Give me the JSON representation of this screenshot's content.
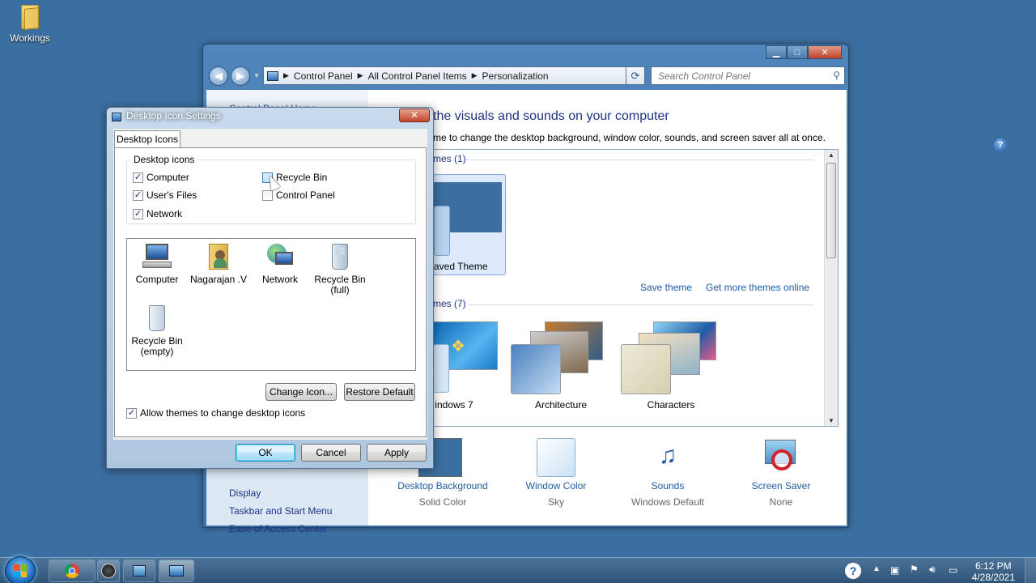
{
  "desktop": {
    "icon_label": "Workings"
  },
  "cp": {
    "address": [
      "Control Panel",
      "All Control Panel Items",
      "Personalization"
    ],
    "search_placeholder": "Search Control Panel",
    "title_partial": "the visuals and sounds on your computer",
    "subtitle_partial": "me to change the desktop background, window color, sounds, and screen saver all at once.",
    "left_top_partial": "Control Panel Home",
    "left_links": [
      "Display",
      "Taskbar and Start Menu",
      "Ease of Access Center"
    ],
    "my_themes_partial": "mes (1)",
    "saved_theme_partial": "aved Theme",
    "save_theme": "Save theme",
    "get_more": "Get more themes online",
    "aero_partial": "mes (7)",
    "themes": [
      "indows 7",
      "Architecture",
      "Characters"
    ],
    "bottom": [
      {
        "label": "Desktop Background",
        "value": "Solid Color"
      },
      {
        "label": "Window Color",
        "value": "Sky"
      },
      {
        "label": "Sounds",
        "value": "Windows Default"
      },
      {
        "label": "Screen Saver",
        "value": "None"
      }
    ]
  },
  "dialog": {
    "title": "Desktop Icon Settings",
    "close": "✕",
    "tab": "Desktop Icons",
    "group": "Desktop icons",
    "checkboxes": [
      {
        "label": "Computer",
        "checked": true
      },
      {
        "label": "Recycle Bin",
        "checked": false
      },
      {
        "label": "User's Files",
        "checked": true
      },
      {
        "label": "Control Panel",
        "checked": false
      },
      {
        "label": "Network",
        "checked": true
      }
    ],
    "icons": [
      "Computer",
      "Nagarajan .V",
      "Network",
      "Recycle Bin (full)",
      "Recycle Bin (empty)"
    ],
    "change_icon": "Change Icon...",
    "restore_default": "Restore Default",
    "allow_themes": "Allow themes to change desktop icons",
    "ok": "OK",
    "cancel": "Cancel",
    "apply": "Apply"
  },
  "taskbar": {
    "time": "6:12 PM",
    "date": "4/28/2021"
  }
}
